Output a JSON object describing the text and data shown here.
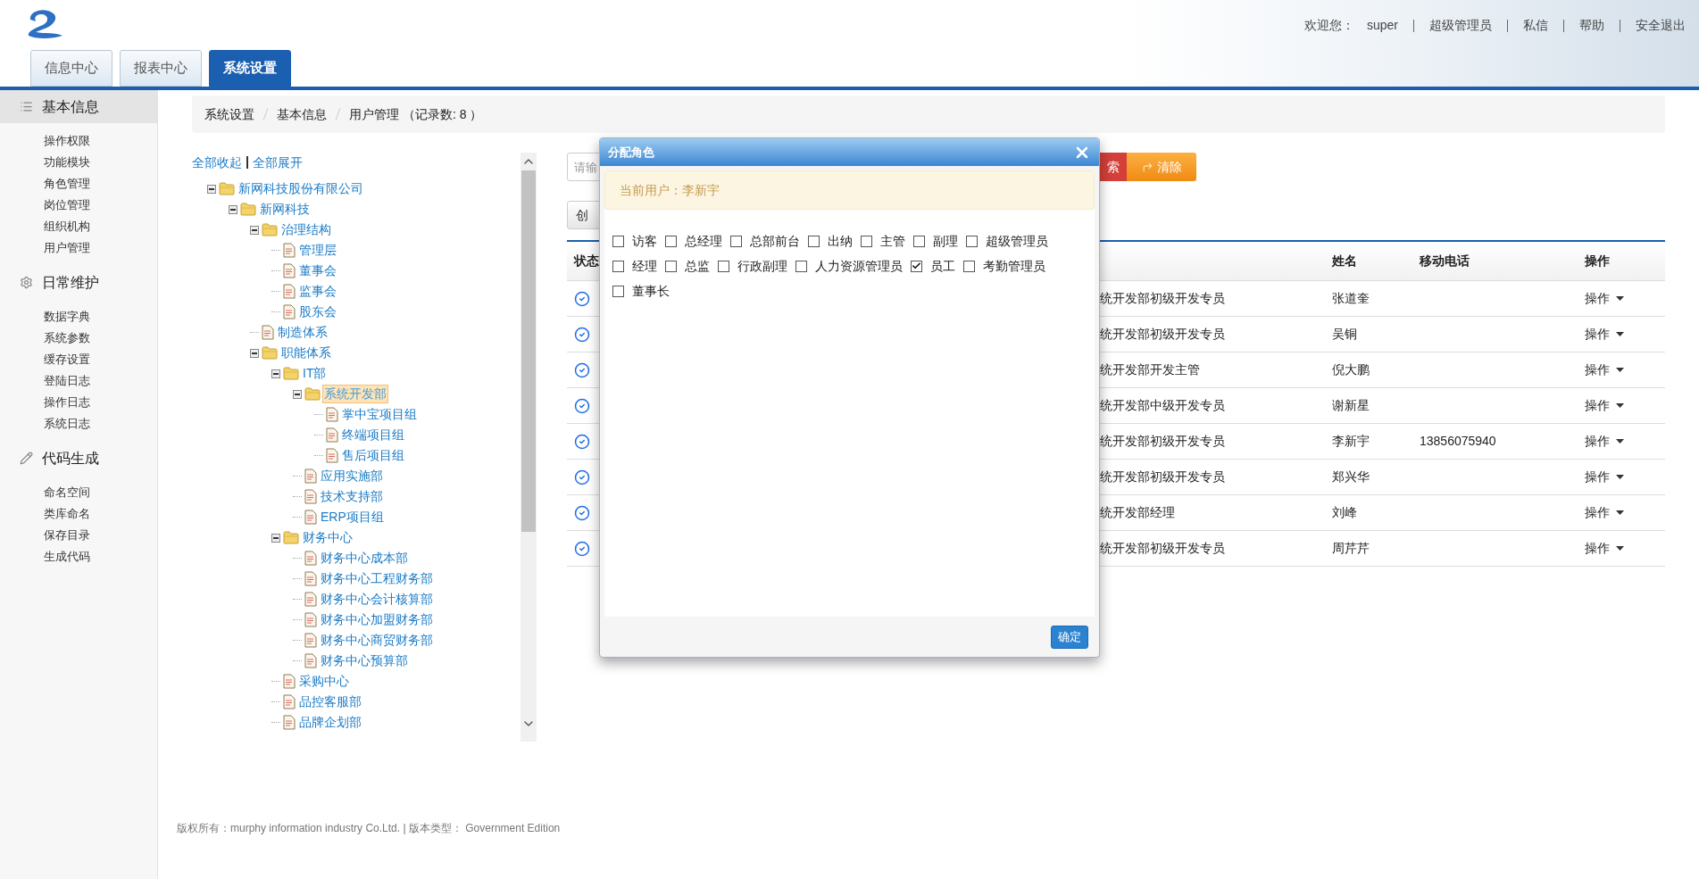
{
  "header": {
    "welcome": "欢迎您：",
    "user": "super",
    "links": [
      "超级管理员",
      "私信",
      "帮助",
      "安全退出"
    ]
  },
  "nav_tabs": [
    {
      "label": "信息中心",
      "selected": false
    },
    {
      "label": "报表中心",
      "selected": false
    },
    {
      "label": "系统设置",
      "selected": true
    }
  ],
  "sidebar": [
    {
      "title": "基本信息",
      "selected": true,
      "items": [
        "操作权限",
        "功能模块",
        "角色管理",
        "岗位管理",
        "组织机构",
        "用户管理"
      ]
    },
    {
      "title": "日常维护",
      "selected": false,
      "items": [
        "数据字典",
        "系统参数",
        "缓存设置",
        "登陆日志",
        "操作日志",
        "系统日志"
      ]
    },
    {
      "title": "代码生成",
      "selected": false,
      "items": [
        "命名空间",
        "类库命名",
        "保存目录",
        "生成代码"
      ]
    }
  ],
  "breadcrumb": [
    "系统设置",
    "基本信息",
    "用户管理 （记录数: 8 ）"
  ],
  "tree": {
    "links": [
      "全部收起",
      "全部展开"
    ],
    "nodes": [
      {
        "kind": "folder",
        "label": "新网科技股份有限公司",
        "expanded": true,
        "selected": false,
        "children": [
          {
            "kind": "folder",
            "label": "新网科技",
            "expanded": true,
            "selected": false,
            "children": [
              {
                "kind": "folder",
                "label": "治理结构",
                "expanded": true,
                "selected": false,
                "children": [
                  {
                    "kind": "file",
                    "label": "管理层",
                    "selected": false
                  },
                  {
                    "kind": "file",
                    "label": "董事会",
                    "selected": false
                  },
                  {
                    "kind": "file",
                    "label": "监事会",
                    "selected": false
                  },
                  {
                    "kind": "file",
                    "label": "股东会",
                    "selected": false
                  }
                ]
              },
              {
                "kind": "file",
                "label": "制造体系",
                "selected": false
              },
              {
                "kind": "folder",
                "label": "职能体系",
                "expanded": true,
                "selected": false,
                "children": [
                  {
                    "kind": "folder",
                    "label": "IT部",
                    "expanded": true,
                    "selected": false,
                    "children": [
                      {
                        "kind": "folder",
                        "label": "系统开发部",
                        "expanded": true,
                        "selected": true,
                        "children": [
                          {
                            "kind": "file",
                            "label": "掌中宝项目组",
                            "selected": false
                          },
                          {
                            "kind": "file",
                            "label": "终端项目组",
                            "selected": false
                          },
                          {
                            "kind": "file",
                            "label": "售后项目组",
                            "selected": false
                          }
                        ]
                      },
                      {
                        "kind": "file",
                        "label": "应用实施部",
                        "selected": false
                      },
                      {
                        "kind": "file",
                        "label": "技术支持部",
                        "selected": false
                      },
                      {
                        "kind": "file",
                        "label": "ERP项目组",
                        "selected": false
                      }
                    ]
                  },
                  {
                    "kind": "folder",
                    "label": "财务中心",
                    "expanded": true,
                    "selected": false,
                    "children": [
                      {
                        "kind": "file",
                        "label": "财务中心成本部",
                        "selected": false
                      },
                      {
                        "kind": "file",
                        "label": "财务中心工程财务部",
                        "selected": false
                      },
                      {
                        "kind": "file",
                        "label": "财务中心会计核算部",
                        "selected": false
                      },
                      {
                        "kind": "file",
                        "label": "财务中心加盟财务部",
                        "selected": false
                      },
                      {
                        "kind": "file",
                        "label": "财务中心商贸财务部",
                        "selected": false
                      },
                      {
                        "kind": "file",
                        "label": "财务中心预算部",
                        "selected": false
                      }
                    ]
                  },
                  {
                    "kind": "file",
                    "label": "采购中心",
                    "selected": false
                  },
                  {
                    "kind": "file",
                    "label": "品控客服部",
                    "selected": false
                  },
                  {
                    "kind": "file",
                    "label": "品牌企划部",
                    "selected": false
                  }
                ]
              }
            ]
          }
        ]
      }
    ]
  },
  "search": {
    "placeholder": "请输",
    "buttons": [
      {
        "kind": "search",
        "label": "索"
      },
      {
        "kind": "clear",
        "label": "清除"
      }
    ]
  },
  "create_button": "创",
  "table": {
    "columns": {
      "status": "状态",
      "name": "姓名",
      "phone": "移动电话",
      "actions": "操作"
    },
    "rows": [
      {
        "position": "统开发部初级开发专员",
        "name": "张道奎",
        "action": "操作"
      },
      {
        "position": "统开发部初级开发专员",
        "name": "吴铜",
        "action": "操作"
      },
      {
        "position": "统开发部开发主管",
        "name": "倪大鹏",
        "action": "操作"
      },
      {
        "position": "统开发部中级开发专员",
        "name": "谢新星",
        "action": "操作"
      },
      {
        "position": "统开发部初级开发专员",
        "name": "李新宇",
        "phone": "13856075940",
        "action": "操作"
      },
      {
        "position": "统开发部初级开发专员",
        "name": "郑兴华",
        "action": "操作"
      },
      {
        "position": "统开发部经理",
        "name": "刘峰",
        "action": "操作"
      },
      {
        "position": "统开发部初级开发专员",
        "name": "周芹芹",
        "action": "操作"
      }
    ]
  },
  "dialog": {
    "title": "分配角色",
    "current_user": "当前用户：李新宇",
    "roles": [
      {
        "label": "访客",
        "checked": false
      },
      {
        "label": "总经理",
        "checked": false
      },
      {
        "label": "总部前台",
        "checked": false
      },
      {
        "label": "出纳",
        "checked": false
      },
      {
        "label": "主管",
        "checked": false
      },
      {
        "label": "副理",
        "checked": false
      },
      {
        "label": "超级管理员",
        "checked": false
      },
      {
        "label": "经理",
        "checked": false
      },
      {
        "label": "总监",
        "checked": false
      },
      {
        "label": "行政副理",
        "checked": false
      },
      {
        "label": "人力资源管理员",
        "checked": false
      },
      {
        "label": "员工",
        "checked": true
      },
      {
        "label": "考勤管理员",
        "checked": false
      },
      {
        "label": "董事长",
        "checked": false
      }
    ],
    "confirm": "确定"
  },
  "footer": "版权所有：murphy information industry Co.Ltd. | 版本类型： Government Edition"
}
